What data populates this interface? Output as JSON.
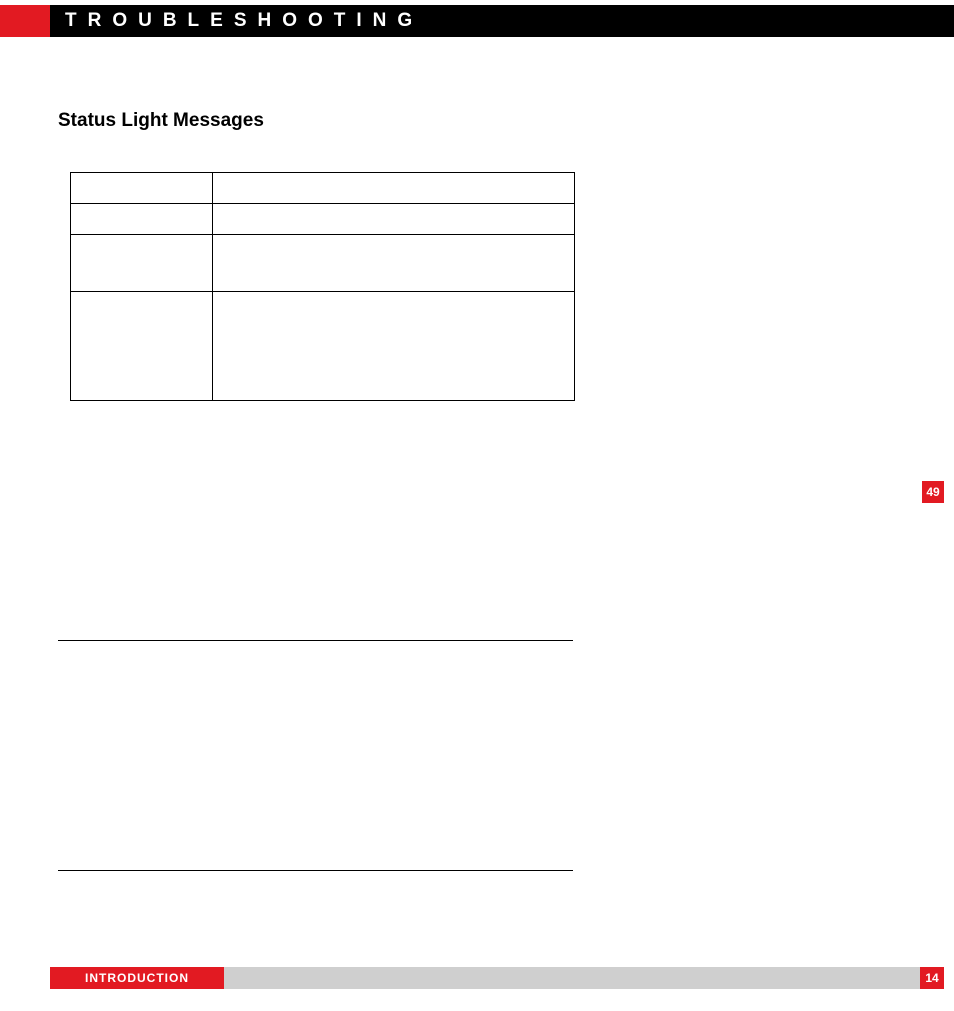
{
  "header": {
    "title": "TROUBLESHOOTING"
  },
  "section": {
    "title": "Status Light Messages"
  },
  "side_tab": {
    "number": "49"
  },
  "footer": {
    "label": "INTRODUCTION",
    "page": "14"
  }
}
